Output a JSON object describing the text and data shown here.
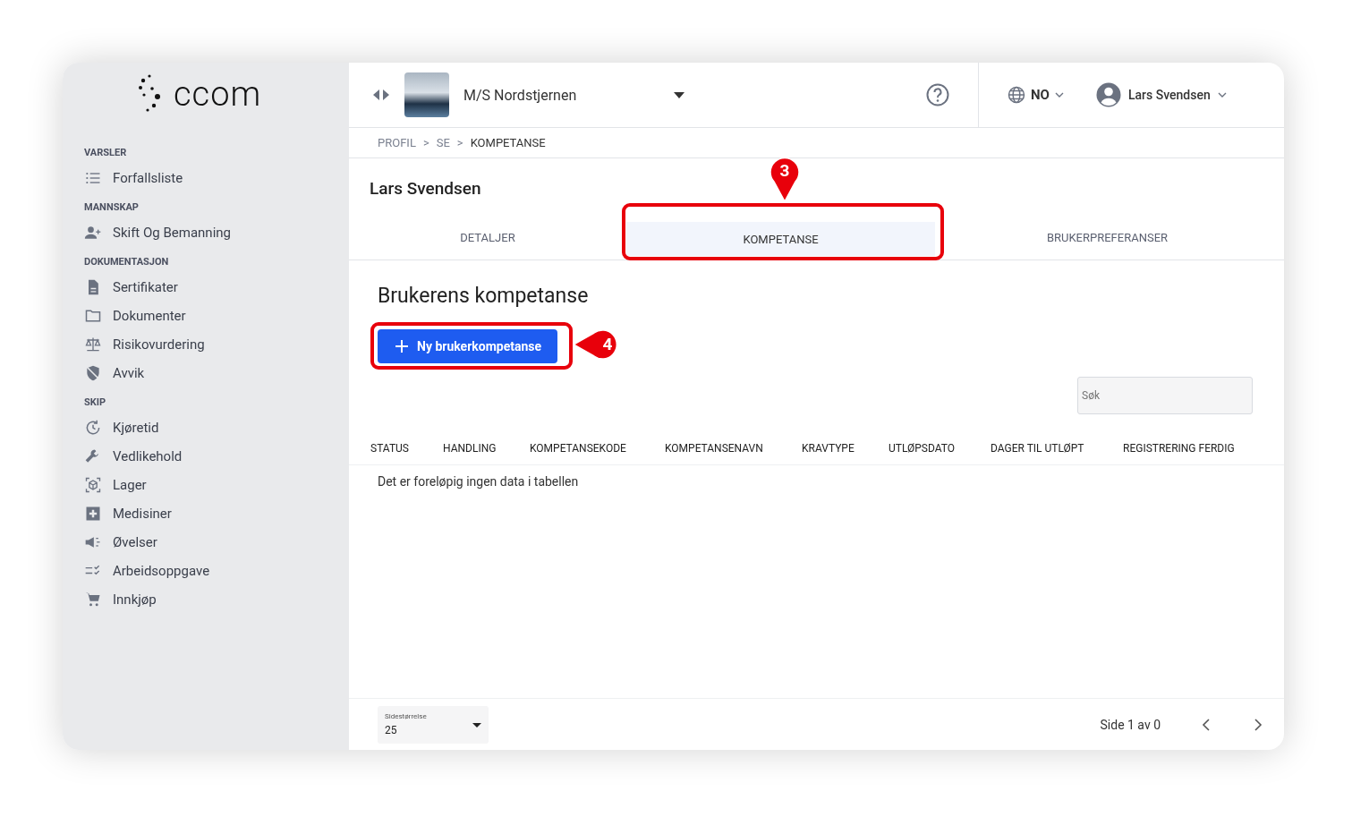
{
  "logo": {
    "text": "ccom"
  },
  "sidebar": {
    "sections": [
      {
        "heading": "VARSLER",
        "items": [
          {
            "label": "Forfallsliste",
            "kind": "list"
          }
        ]
      },
      {
        "heading": "MANNSKAP",
        "items": [
          {
            "label": "Skift Og Bemanning",
            "kind": "people"
          }
        ]
      },
      {
        "heading": "DOKUMENTASJON",
        "items": [
          {
            "label": "Sertifikater",
            "kind": "document"
          },
          {
            "label": "Dokumenter",
            "kind": "folder"
          },
          {
            "label": "Risikovurdering",
            "kind": "scale"
          },
          {
            "label": "Avvik",
            "kind": "shield"
          }
        ]
      },
      {
        "heading": "SKIP",
        "items": [
          {
            "label": "Kjøretid",
            "kind": "history"
          },
          {
            "label": "Vedlikehold",
            "kind": "wrench"
          },
          {
            "label": "Lager",
            "kind": "cube"
          },
          {
            "label": "Medisiner",
            "kind": "medical"
          },
          {
            "label": "Øvelser",
            "kind": "megaphone"
          },
          {
            "label": "Arbeidsoppgave",
            "kind": "checklist"
          },
          {
            "label": "Innkjøp",
            "kind": "cart"
          }
        ]
      }
    ]
  },
  "header": {
    "vessel": "M/S Nordstjernen",
    "language": "NO",
    "user": "Lars Svendsen"
  },
  "breadcrumb": {
    "separator": ">",
    "items": [
      {
        "label": "PROFIL",
        "current": false
      },
      {
        "label": "SE",
        "current": false
      },
      {
        "label": "KOMPETANSE",
        "current": true
      }
    ]
  },
  "profile": {
    "title": "Lars Svendsen"
  },
  "tabs": [
    {
      "label": "DETALJER",
      "selected": false
    },
    {
      "label": "KOMPETANSE",
      "selected": true
    },
    {
      "label": "BRUKERPREFERANSER",
      "selected": false
    }
  ],
  "section": {
    "title": "Brukerens kompetanse",
    "add_button": "Ny brukerkompetanse",
    "search": {
      "placeholder": "Søk"
    }
  },
  "table": {
    "columns": [
      "STATUS",
      "HANDLING",
      "KOMPETANSEKODE",
      "KOMPETANSENAVN",
      "KRAVTYPE",
      "UTLØPSDATO",
      "DAGER TIL UTLØPT",
      "REGISTRERING FERDIG"
    ],
    "empty_message": "Det er foreløpig ingen data i tabellen"
  },
  "footer": {
    "page_size_label": "Sidestørrelse",
    "page_size": "25",
    "page_info": "Side 1 av 0"
  },
  "annotations": [
    {
      "label": "3",
      "kind": "down"
    },
    {
      "label": "4",
      "kind": "left"
    }
  ]
}
